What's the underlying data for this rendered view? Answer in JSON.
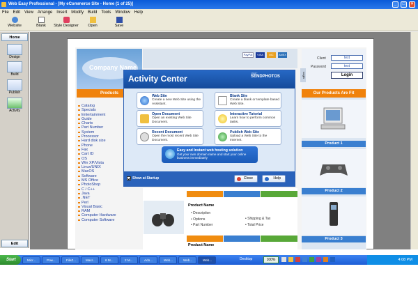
{
  "window": {
    "title": "Web Easy Professional - [My eCommerce Site - Home (1 of 25)]"
  },
  "menu": [
    "File",
    "Edit",
    "View",
    "Arrange",
    "Insert",
    "Modify",
    "Build",
    "Tools",
    "Window",
    "Help"
  ],
  "toolbar": [
    {
      "label": "Website",
      "icon": "website-icon"
    },
    {
      "label": "Blank",
      "icon": "blank-page-icon"
    },
    {
      "label": "Style Designer",
      "icon": "style-designer-icon"
    },
    {
      "label": "Open",
      "icon": "open-folder-icon"
    },
    {
      "label": "Save",
      "icon": "save-disk-icon"
    }
  ],
  "left_panel": {
    "header": "Home",
    "items": [
      "Design",
      "Build",
      "Publish",
      "Activity"
    ],
    "footer": "Edit"
  },
  "site": {
    "company_name": "Company Name",
    "products_header": "Products",
    "categories": [
      "Catalog",
      "Specials",
      "Entertainment",
      "Guide",
      "Charts",
      "Part Number",
      "System",
      "Processor",
      "Hard disk size",
      "Phone",
      "Fax",
      "Cart ID",
      "OS",
      "Win XP/Vista",
      "Linux/UNIX",
      "MacOS",
      "Software",
      "MS Office",
      "PhotoShop",
      "C / C++",
      "Java",
      ".NET",
      "Perl",
      "Visual Basic",
      "RAM",
      "Computer Hardware",
      "Computer Software"
    ],
    "login": {
      "client_label": "Client",
      "client_value": "text",
      "password_label": "Password",
      "password_value": "text",
      "button": "Login"
    },
    "login_tab": "Login",
    "our_products_header": "Our Products Are Fit",
    "products": [
      "Product 1",
      "Product 2",
      "Product 3"
    ],
    "product_block": {
      "name": "Product Name",
      "left": [
        "Description",
        "Options",
        "Part Number"
      ],
      "right": [
        "Shipping & Tax",
        "Total Price"
      ],
      "name2": "Product Name"
    },
    "payment_logos": [
      "PayPal",
      "VISA",
      "MC",
      "AMEX"
    ]
  },
  "dialog": {
    "title": "Activity Center",
    "brand_small": "Visit:",
    "brand": "SENDPHOTOS",
    "cards": [
      {
        "title": "Web Site",
        "desc": "Create a new Web Site using the Assistant."
      },
      {
        "title": "Blank Site",
        "desc": "Create a blank or template based Web Site."
      },
      {
        "title": "Open Document",
        "desc": "Open an existing Web Site Document."
      },
      {
        "title": "Interactive Tutorial",
        "desc": "Learn how to perform common tasks."
      },
      {
        "title": "Recent Document",
        "desc": "Open the most recent Web Site Document."
      },
      {
        "title": "Publish Web Site",
        "desc": "Upload a Web Site to the Internet."
      }
    ],
    "banner_title": "Easy and Instant web hosting solution",
    "banner_sub": "Get your own domain name and start your online business immediately",
    "show_at_startup": "Show at Startup",
    "close": "Close",
    "help": "Help"
  },
  "taskbar": {
    "start": "Start",
    "tasks": [
      "Micr...",
      "Pow...",
      "FileZ...",
      "Macr...",
      "6 M...",
      "2 M...",
      "Ado...",
      "Web...",
      "Web...",
      "Web..."
    ],
    "desktop": "Desktop",
    "zoom": "100%",
    "time": "4:08 PM"
  }
}
